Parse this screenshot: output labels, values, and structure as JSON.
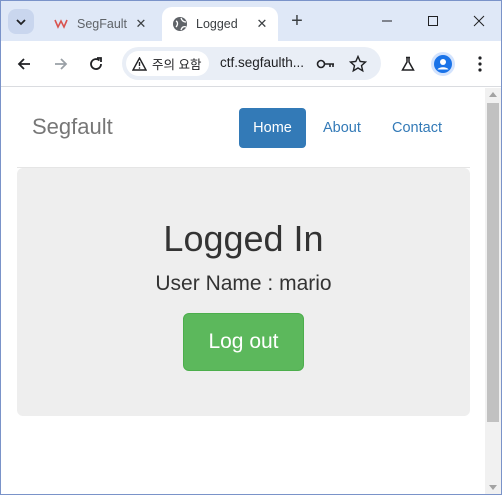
{
  "browser": {
    "tabs": [
      {
        "title": "SegFault",
        "active": false,
        "favicon": "segfault-favicon"
      },
      {
        "title": "Logged",
        "active": true,
        "favicon": "globe-icon"
      }
    ],
    "new_tab_label": "+",
    "address_bar": {
      "security_chip": "주의 요함",
      "url": "ctf.segfaulth..."
    }
  },
  "page": {
    "brand": "Segfault",
    "nav": {
      "home": "Home",
      "about": "About",
      "contact": "Contact"
    },
    "jumbotron": {
      "heading": "Logged In",
      "username_line": "User Name : mario",
      "logout_button": "Log out"
    }
  },
  "colors": {
    "primary": "#337ab7",
    "success": "#5cb85c",
    "jumbotron_bg": "#eeeeee",
    "tabstrip_bg": "#dfe8f7"
  }
}
